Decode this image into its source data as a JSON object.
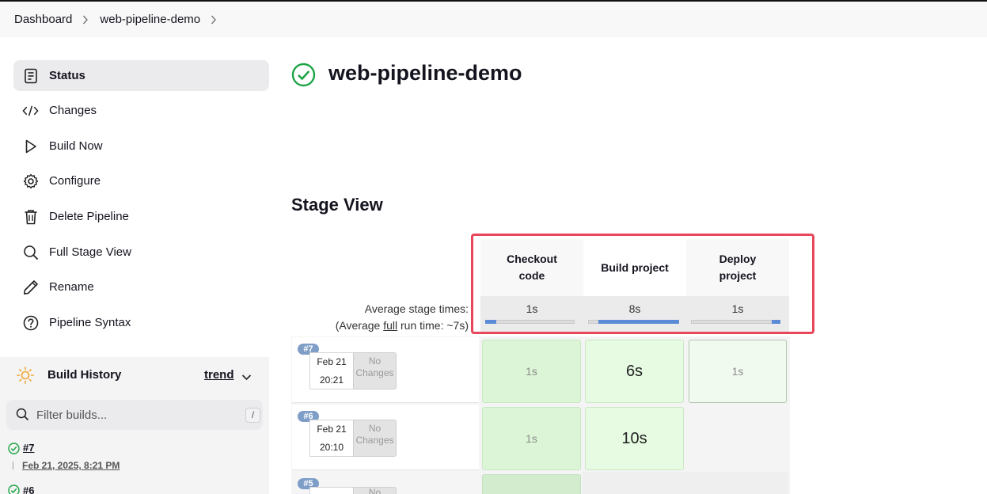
{
  "breadcrumb": [
    {
      "label": "Dashboard"
    },
    {
      "label": "web-pipeline-demo"
    }
  ],
  "sidebar": {
    "items": [
      {
        "label": "Status",
        "icon": "status-icon",
        "active": true
      },
      {
        "label": "Changes",
        "icon": "code-icon"
      },
      {
        "label": "Build Now",
        "icon": "play-icon"
      },
      {
        "label": "Configure",
        "icon": "gear-icon"
      },
      {
        "label": "Delete Pipeline",
        "icon": "trash-icon"
      },
      {
        "label": "Full Stage View",
        "icon": "search-icon"
      },
      {
        "label": "Rename",
        "icon": "pencil-icon"
      },
      {
        "label": "Pipeline Syntax",
        "icon": "help-icon"
      }
    ]
  },
  "build_history": {
    "title": "Build History",
    "trend_label": "trend",
    "filter_placeholder": "Filter builds...",
    "filter_shortcut": "/",
    "builds": [
      {
        "number": "#7",
        "date": "Feb 21, 2025, 8:21 PM",
        "status": "success"
      },
      {
        "number": "#6",
        "status": "success"
      }
    ]
  },
  "job": {
    "title": "web-pipeline-demo",
    "status": "success"
  },
  "stage_view": {
    "title": "Stage View",
    "avg_label_line1": "Average stage times:",
    "avg_label_line2_prefix": "(Average ",
    "avg_label_link": "full",
    "avg_label_line2_suffix": " run time: ~7s)",
    "stages": [
      {
        "name_line1": "Checkout",
        "name_line2": "code",
        "avg": "1s",
        "bar_fraction": 0.12
      },
      {
        "name_line1": "Build project",
        "name_line2": "",
        "avg": "8s",
        "bar_fraction": 0.9
      },
      {
        "name_line1": "Deploy",
        "name_line2": "project",
        "avg": "1s",
        "bar_fraction": 0.1
      }
    ],
    "runs": [
      {
        "badge": "#7",
        "date": "Feb 21",
        "time": "20:21",
        "changes_line1": "No",
        "changes_line2": "Changes",
        "durations": [
          "1s",
          "6s",
          "1s"
        ]
      },
      {
        "badge": "#6",
        "date": "Feb 21",
        "time": "20:10",
        "changes_line1": "No",
        "changes_line2": "Changes",
        "durations": [
          "1s",
          "10s",
          ""
        ]
      },
      {
        "badge": "#5",
        "changes_line1": "No"
      }
    ]
  }
}
